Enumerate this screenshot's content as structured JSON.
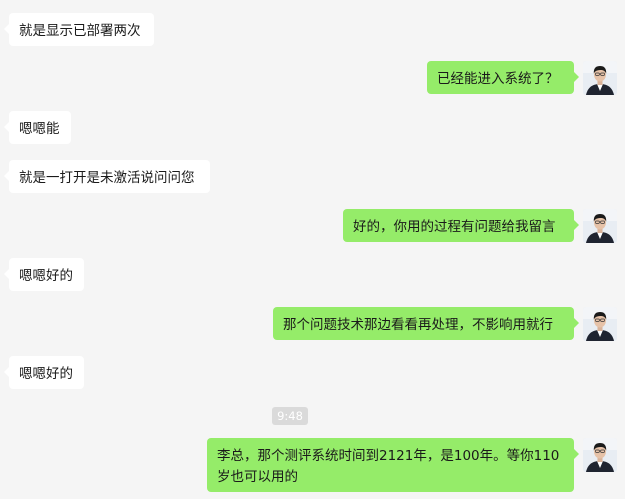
{
  "messages": [
    {
      "side": "left",
      "text": "就是显示已部署两次"
    },
    {
      "side": "right",
      "text": "已经能进入系统了？"
    },
    {
      "side": "left",
      "text": "嗯嗯能"
    },
    {
      "side": "left",
      "text": "就是一打开是未激活说问问您"
    },
    {
      "side": "right",
      "text": "好的，你用的过程有问题给我留言"
    },
    {
      "side": "left",
      "text": "嗯嗯好的"
    },
    {
      "side": "right",
      "text": "那个问题技术那边看看再处理，不影响用就行"
    },
    {
      "side": "left",
      "text": "嗯嗯好的"
    },
    {
      "side": "right",
      "text": "李总，那个测评系统时间到2121年，是100年。等你110岁也可以用的"
    }
  ],
  "timestamp": "9:48",
  "colors": {
    "background": "#f5f5f5",
    "incoming_bubble": "#ffffff",
    "outgoing_bubble": "#95ec69",
    "timestamp_bg": "#dadada"
  },
  "avatar_icon": "user-avatar-photo"
}
